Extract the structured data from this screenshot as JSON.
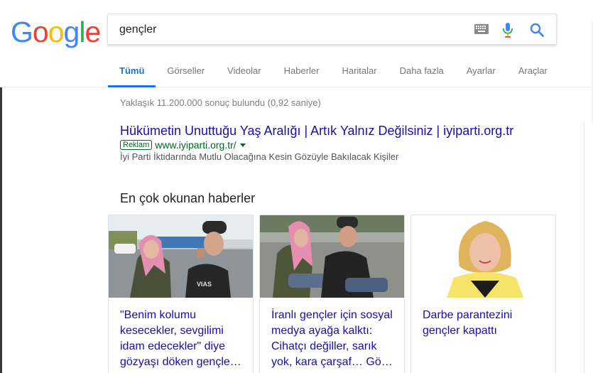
{
  "search": {
    "query": "gençler"
  },
  "logo": {
    "letters": [
      "G",
      "o",
      "o",
      "g",
      "l",
      "e"
    ],
    "colors": [
      "#4285f4",
      "#ea4335",
      "#fbbc05",
      "#4285f4",
      "#34a853",
      "#ea4335"
    ]
  },
  "tabs": [
    {
      "label": "Tümü",
      "active": true
    },
    {
      "label": "Görseller"
    },
    {
      "label": "Videolar"
    },
    {
      "label": "Haberler"
    },
    {
      "label": "Haritalar"
    },
    {
      "label": "Daha fazla"
    },
    {
      "label": "Ayarlar"
    },
    {
      "label": "Araçlar"
    }
  ],
  "results_stats": "Yaklaşık 11.200.000 sonuç bulundu (0,92 saniye)",
  "ad": {
    "title": "Hükümetin Unuttuğu Yaş Aralığı | Artık Yalnız Değilsiniz | iyiparti.org.tr",
    "badge": "Reklam",
    "url": "www.iyiparti.org.tr/",
    "description": "İyi Parti İktidarında Mutlu Olacağına Kesin Gözüyle Bakılacak Kişiler"
  },
  "news": {
    "heading": "En çok okunan haberler",
    "cards": [
      {
        "title": "\"Benim kolumu kesecekler, sevgilimi idam edecekler\" diye gözyaşı döken gençle…"
      },
      {
        "title": "İranlı gençler için sosyal medya ayağa kalktı: Cihatçı değiller, sarık yok, kara çarşaf… Gö…"
      },
      {
        "title": "Darbe parantezini gençler kapattı"
      }
    ]
  },
  "colors": {
    "accent": "#1a73e8",
    "link": "#1a0dab",
    "url_green": "#006621"
  }
}
